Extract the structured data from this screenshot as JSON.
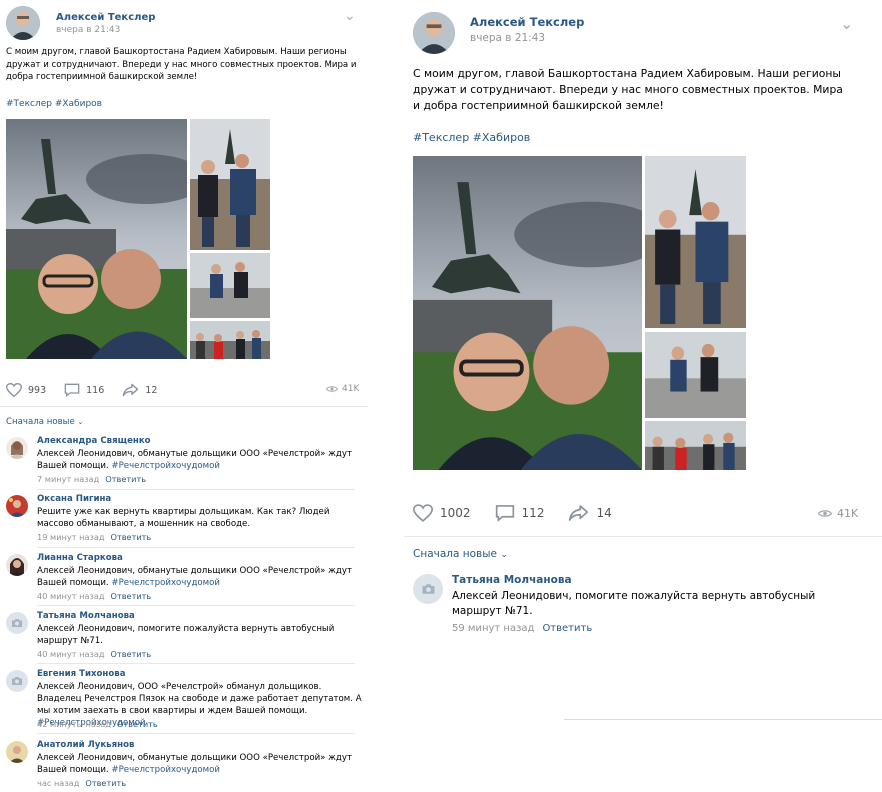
{
  "left_post": {
    "author": "Алексей Текслер",
    "time": "вчера в 21:43",
    "text": "С моим другом, главой Башкортостана Радием Хабировым. Наши регионы дружат и сотрудничают. Впереди у нас много совместных проектов. Мира и добра гостеприимной башкирской земле!",
    "tags": "#Текслер #Хабиров",
    "likes": "993",
    "comments": "116",
    "shares": "12",
    "views": "41K",
    "sort_label": "Сначала новые"
  },
  "left_comments": [
    {
      "name": "Александра Священко",
      "text": "Алексей Леонидович, обманутые дольщики ООО «Речелстрой» ждут Вашей помощи.",
      "hashtag": "#Речелстройхочудомой",
      "time": "7 минут назад",
      "reply": "Ответить"
    },
    {
      "name": "Оксана Пигина",
      "text": "Решите уже как вернуть квартиры дольщикам. Как так? Людей массово обманывают, а мошенник на свободе.",
      "hashtag": "",
      "time": "19 минут назад",
      "reply": "Ответить"
    },
    {
      "name": "Лианна Старкова",
      "text": "Алексей Леонидович, обманутые дольщики ООО «Речелстрой» ждут Вашей помощи.",
      "hashtag": "#Речелстройхочудомой",
      "time": "40 минут назад",
      "reply": "Ответить"
    },
    {
      "name": "Татьяна Молчанова",
      "text": "Алексей Леонидович, помогите пожалуйста вернуть автобусный маршрут №71.",
      "hashtag": "",
      "time": "40 минут назад",
      "reply": "Ответить"
    },
    {
      "name": "Евгения Тихонова",
      "text": "Алексей Леонидович, ООО «Речелстрой» обманул дольщиков. Владелец Речелстроя Пязок на свободе и даже работает депутатом. А мы хотим заехать в свои квартиры и ждем Вашей помощи.",
      "hashtag": "#Речелстройхочудомой",
      "time": "42 минуты назад",
      "reply": "Ответить"
    },
    {
      "name": "Анатолий Лукьянов",
      "text": "Алексей Леонидович, обманутые дольщики ООО «Речелстрой» ждут Вашей помощи.",
      "hashtag": "#Речелстройхочудомой",
      "time": "час назад",
      "reply": "Ответить"
    }
  ],
  "right_post": {
    "author": "Алексей Текслер",
    "time": "вчера в 21:43",
    "text": "С моим другом, главой Башкортостана Радием Хабировым. Наши регионы дружат и сотрудничают. Впереди у нас много совместных проектов. Мира и добра гостеприимной башкирской земле!",
    "tags": "#Текслер #Хабиров",
    "likes": "1002",
    "comments": "112",
    "shares": "14",
    "views": "41K",
    "sort_label": "Сначала новые"
  },
  "right_comment": {
    "name": "Татьяна Молчанова",
    "text": "Алексей Леонидович, помогите пожалуйста вернуть автобусный маршрут №71.",
    "time": "59 минут назад",
    "reply": "Ответить"
  },
  "icons": {
    "like": "heart-icon",
    "comment": "comment-icon",
    "share": "share-arrow-icon",
    "views": "eye-icon",
    "menu": "chevron-down-icon",
    "camera": "camera-icon"
  },
  "colors": {
    "link": "#2a5885",
    "meta": "#939393",
    "divider": "#e7e8ec"
  }
}
